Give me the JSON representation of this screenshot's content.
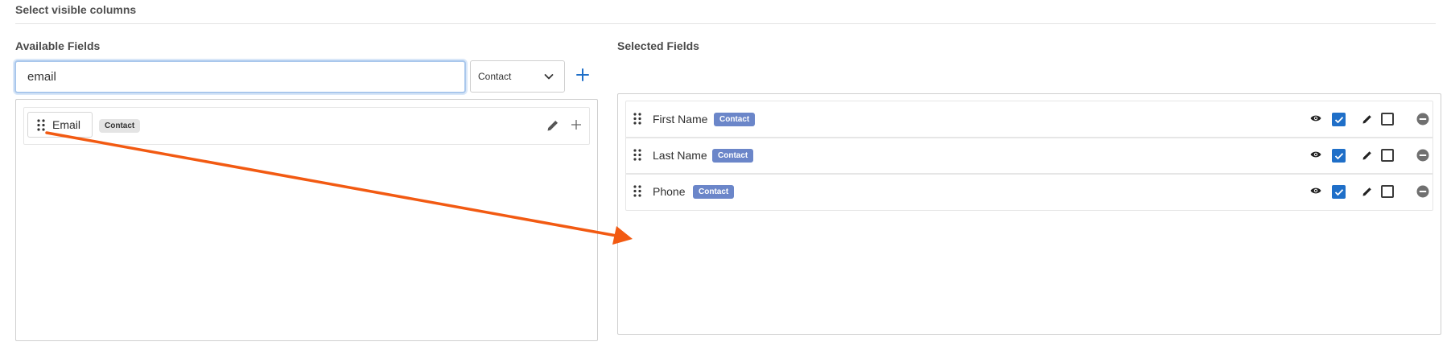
{
  "header": {
    "title": "Select visible columns"
  },
  "available": {
    "label": "Available Fields",
    "search": {
      "value": "email",
      "placeholder": ""
    },
    "type_select": {
      "value": "Contact"
    },
    "fields": [
      {
        "name": "Email",
        "badge": "Contact"
      }
    ]
  },
  "selected": {
    "label": "Selected Fields",
    "fields": [
      {
        "name": "First Name",
        "badge": "Contact",
        "visible": true,
        "editable": false
      },
      {
        "name": "Last Name",
        "badge": "Contact",
        "visible": true,
        "editable": false
      },
      {
        "name": "Phone",
        "badge": "Contact",
        "visible": true,
        "editable": false
      }
    ]
  },
  "colors": {
    "accent_blue": "#1f6fc8",
    "badge_blue": "#6b86c9",
    "annotation_arrow": "#f25a12"
  },
  "icons": {
    "drag": "drag-handle-icon",
    "edit": "pencil-icon",
    "add": "plus-icon",
    "visible": "eye-icon",
    "remove": "minus-circle-icon",
    "dropdown": "chevron-down-icon"
  }
}
